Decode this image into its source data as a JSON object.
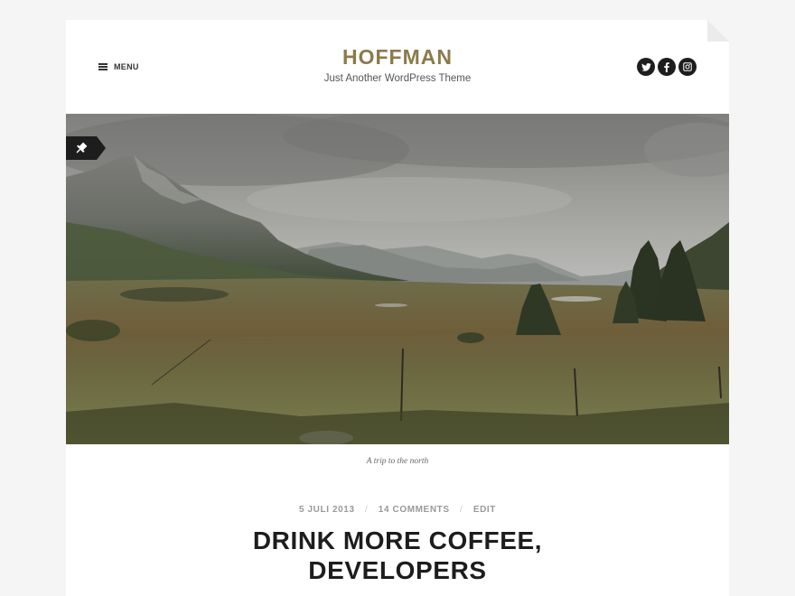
{
  "header": {
    "menu_label": "MENU",
    "site_title": "HOFFMAN",
    "site_description": "Just Another WordPress Theme",
    "social": [
      {
        "icon": "twitter-icon"
      },
      {
        "icon": "facebook-icon"
      },
      {
        "icon": "instagram-icon"
      }
    ]
  },
  "post": {
    "sticky_icon": "pushpin-icon",
    "image_caption": "A trip to the north",
    "date": "5 JULI 2013",
    "comments": "14 COMMENTS",
    "edit": "EDIT",
    "title_line1": "DRINK MORE COFFEE,",
    "title_line2": "DEVELOPERS"
  },
  "colors": {
    "accent": "#8c7a4a",
    "text_dark": "#1d1d1d",
    "meta_gray": "#999999",
    "background": "#f5f5f5"
  }
}
